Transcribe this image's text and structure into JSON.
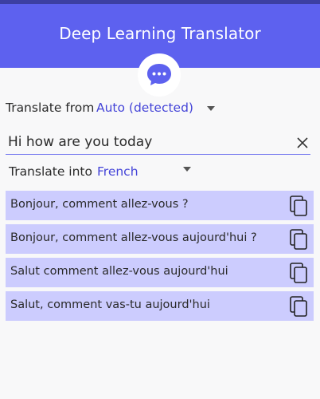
{
  "header": {
    "title": "Deep Learning Translator",
    "logo_icon": "chat-bubble-icon"
  },
  "source": {
    "label": "Translate from",
    "language": "Auto (detected)"
  },
  "input": {
    "value": "Hi how are you today",
    "clear_icon": "close-icon"
  },
  "target": {
    "label": "Translate into",
    "language": "French"
  },
  "results": [
    {
      "text": "Bonjour, comment allez-vous ?"
    },
    {
      "text": "Bonjour, comment allez-vous aujourd'hui ?"
    },
    {
      "text": "Salut comment allez-vous aujourd'hui"
    },
    {
      "text": "Salut, comment vas-tu aujourd'hui"
    }
  ],
  "colors": {
    "header": "#5d61ef",
    "accent": "#4444d8",
    "card": "#ccccfe"
  }
}
